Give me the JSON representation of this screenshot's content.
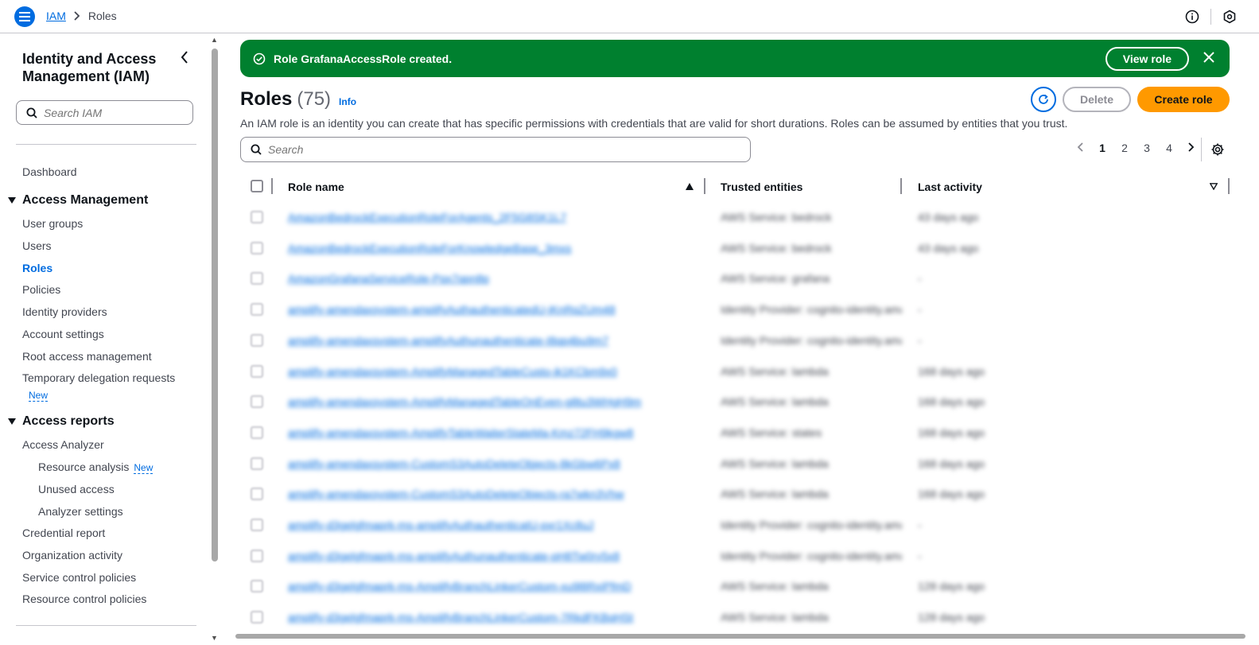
{
  "topbar": {
    "breadcrumb_root": "IAM",
    "breadcrumb_current": "Roles"
  },
  "sidebar": {
    "title": "Identity and Access Management (IAM)",
    "search_placeholder": "Search IAM",
    "dashboard": "Dashboard",
    "section_access_management": "Access Management",
    "items_access_management": [
      "User groups",
      "Users",
      "Roles",
      "Policies",
      "Identity providers",
      "Account settings",
      "Root access management",
      "Temporary delegation requests"
    ],
    "temp_delegation_badge": "New",
    "section_access_reports": "Access reports",
    "access_analyzer": "Access Analyzer",
    "resource_analysis": "Resource analysis",
    "resource_analysis_badge": "New",
    "unused_access": "Unused access",
    "analyzer_settings": "Analyzer settings",
    "credential_report": "Credential report",
    "organization_activity": "Organization activity",
    "service_control_policies": "Service control policies",
    "resource_control_policies": "Resource control policies"
  },
  "flash": {
    "message": "Role GrafanaAccessRole created.",
    "view_role_label": "View role"
  },
  "header": {
    "title": "Roles",
    "count": "(75)",
    "info": "Info",
    "description": "An IAM role is an identity you can create that has specific permissions with credentials that are valid for short durations. Roles can be assumed by entities that you trust.",
    "delete_label": "Delete",
    "create_label": "Create role"
  },
  "search": {
    "placeholder": "Search"
  },
  "pagination": {
    "pages": [
      "1",
      "2",
      "3",
      "4"
    ],
    "current": "1"
  },
  "table": {
    "columns": [
      "Role name",
      "Trusted entities",
      "Last activity"
    ],
    "rows": [
      {
        "name": "AmazonBedrockExecutionRoleForAgents_2F5G8SK1L7",
        "trusted": "AWS Service: bedrock",
        "last": "43 days ago"
      },
      {
        "name": "AmazonBedrockExecutionRoleForKnowledgeBase_3mxs",
        "trusted": "AWS Service: bedrock",
        "last": "43 days ago"
      },
      {
        "name": "AmazonGrafanaServiceRole-Pqx7qpn8p",
        "trusted": "AWS Service: grafana",
        "last": "-"
      },
      {
        "name": "amplify-amendaxsystem-amplifyAuthauthenticatedU-jKnRqZUm48",
        "trusted": "Identity Provider: cognito-identity.amazonaws.com",
        "last": "-"
      },
      {
        "name": "amplify-amendaxsystem-amplifyAuthunauthenticate-I8qp4bu9m7",
        "trusted": "Identity Provider: cognito-identity.amazonaws.com",
        "last": "-"
      },
      {
        "name": "amplify-amendaxsystem-AmplifyManagedTableCusto-jk1KCbm9x0",
        "trusted": "AWS Service: lambda",
        "last": "168 days ago"
      },
      {
        "name": "amplify-amendaxsystem-AmplifyManagedTableOnEven-g8tu3WHgH9m",
        "trusted": "AWS Service: lambda",
        "last": "168 days ago"
      },
      {
        "name": "amplify-amendaxsystem-AmplifyTableWaiterStateMa-Kmz72FH9kgw8",
        "trusted": "AWS Service: states",
        "last": "168 days ago"
      },
      {
        "name": "amplify-amendaxsystem-CustomS3AutoDeleteObjects-8kGbw6Px8",
        "trusted": "AWS Service: lambda",
        "last": "168 days ago"
      },
      {
        "name": "amplify-amendaxsystem-CustomS3AutoDeleteObjects-ra7wkn3Vhw",
        "trusted": "AWS Service: lambda",
        "last": "168 days ago"
      },
      {
        "name": "amplify-d3gelgfmaprk-ms-amplifyAuthauthenticatU-pxr1Xc8uJ",
        "trusted": "Identity Provider: cognito-identity.amazonaws.com",
        "last": "-"
      },
      {
        "name": "amplify-d3gelgfmaprk-ms-amplifyAuthunauthenticate-pH8Tw0ry5x8",
        "trusted": "Identity Provider: cognito-identity.amazonaws.com",
        "last": "-"
      },
      {
        "name": "amplify-d3gelgfmaprk-ms-AmplifyBranchLinkerCustom-xu9l8RxiPfmD",
        "trusted": "AWS Service: lambda",
        "last": "128 days ago"
      },
      {
        "name": "amplify-d3gelgfmaprk-ms-AmplifyBranchLinkerCustom-7RkdFKBqHSt",
        "trusted": "AWS Service: lambda",
        "last": "128 days ago"
      }
    ]
  },
  "colors": {
    "accent": "#006ce0",
    "success": "#00802f",
    "primary_button": "#ff9900"
  }
}
